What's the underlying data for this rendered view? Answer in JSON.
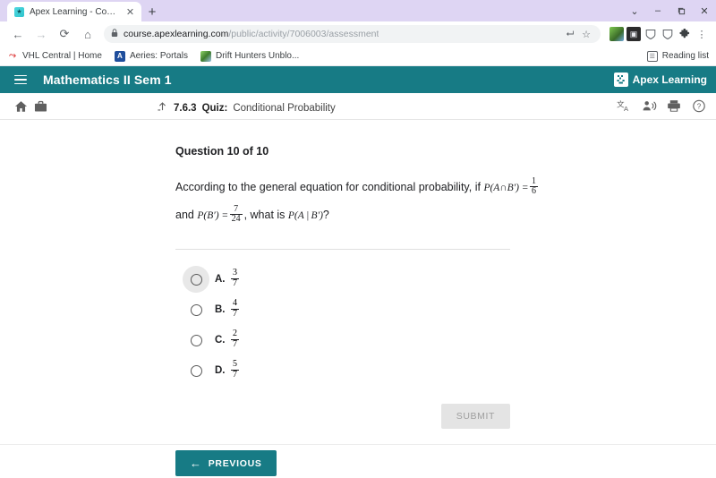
{
  "browser": {
    "tab": {
      "title": "Apex Learning - Courses",
      "favicon": "apex-favicon",
      "close_label": "✕"
    },
    "newtab_label": "+",
    "window_controls": [
      {
        "name": "tab-search",
        "glyph": "⌄"
      },
      {
        "name": "minimize",
        "glyph": "–"
      },
      {
        "name": "maximize",
        "glyph": "❐"
      },
      {
        "name": "close",
        "glyph": "✕"
      }
    ],
    "nav": {
      "back": "←",
      "forward": "→",
      "reload": "⟳",
      "home": "⌂"
    },
    "omnibox": {
      "lock": "🔒",
      "url_host": "course.apexlearning.com",
      "url_path": "/public/activity/7006003/assessment",
      "share": "⮠",
      "bookmark_star": "☆"
    },
    "extensions": [
      {
        "name": "drift-hunters-extension",
        "glyph": ""
      },
      {
        "name": "dark-extension",
        "glyph": "▣"
      },
      {
        "name": "shield-extension-1",
        "glyph": "⛊"
      },
      {
        "name": "shield-extension-2",
        "glyph": "⛊"
      },
      {
        "name": "puzzle-extensions",
        "glyph": "✽"
      },
      {
        "name": "chrome-menu",
        "glyph": "⋮"
      }
    ],
    "bookmarks": [
      {
        "label": "VHL Central | Home",
        "icon": "vhl-icon",
        "glyph": "⤳"
      },
      {
        "label": "Aeries: Portals",
        "icon": "aeries-icon",
        "glyph": "A"
      },
      {
        "label": "Drift Hunters Unblo...",
        "icon": "drift-icon",
        "glyph": ""
      }
    ],
    "reading_list": {
      "label": "Reading list",
      "glyph": "☰"
    }
  },
  "app": {
    "menu_icon": "hamburger-icon",
    "course_title": "Mathematics II Sem 1",
    "brand": {
      "mark": "☸",
      "name": "Apex Learning"
    },
    "subbar": {
      "left_icons": [
        {
          "name": "home-icon",
          "glyph": "⌂"
        },
        {
          "name": "briefcase-icon",
          "glyph": "💼"
        }
      ],
      "breadcrumb": {
        "up_icon": "⤴",
        "number": "7.6.3",
        "kind": "Quiz:",
        "name": "Conditional Probability"
      },
      "right_icons": [
        {
          "name": "translate-icon",
          "glyph": "文A"
        },
        {
          "name": "read-aloud-icon",
          "glyph": "🗣"
        },
        {
          "name": "print-icon",
          "glyph": "⎙"
        },
        {
          "name": "help-icon",
          "glyph": "?"
        }
      ]
    }
  },
  "question": {
    "heading": "Question 10 of 10",
    "stem_part1": "According to the general equation for conditional probability, if",
    "expr1_label": "P(A∩B′)",
    "expr1_eq": "=",
    "expr1_num": "1",
    "expr1_den": "6",
    "stem_part2": "and",
    "expr2_label": "P(B′)",
    "expr2_eq": "=",
    "expr2_num": "7",
    "expr2_den": "24",
    "stem_part3": ", what is",
    "expr3_label": "P(A | B′)",
    "stem_part4": "?",
    "choices": [
      {
        "letter": "A.",
        "num": "3",
        "den": "7",
        "state": "hover"
      },
      {
        "letter": "B.",
        "num": "4",
        "den": "7",
        "state": "normal"
      },
      {
        "letter": "C.",
        "num": "2",
        "den": "7",
        "state": "normal"
      },
      {
        "letter": "D.",
        "num": "5",
        "den": "7",
        "state": "normal"
      }
    ],
    "submit_label": "SUBMIT",
    "submit_enabled": false
  },
  "footer": {
    "previous_label": "PREVIOUS",
    "previous_arrow": "←"
  },
  "colors": {
    "teal": "#177b85",
    "tabstrip": "#ded5f3",
    "disabled_button_bg": "#e4e4e4",
    "disabled_button_text": "#9e9e9e"
  }
}
